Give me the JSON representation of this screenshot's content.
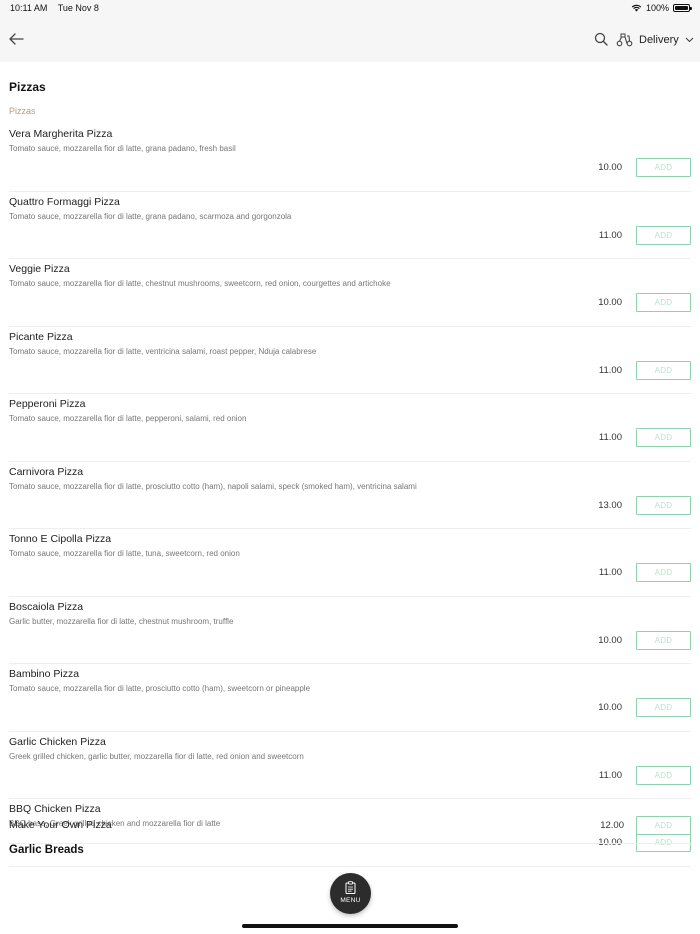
{
  "status_bar": {
    "time": "10:11 AM",
    "date": "Tue Nov 8",
    "battery": "100%",
    "battery_level": 1.0
  },
  "nav": {
    "back_icon": "arrow-left-icon",
    "search_icon": "search-icon",
    "delivery_icon": "scooter-icon",
    "delivery_label": "Delivery",
    "chevron_icon": "chevron-down-icon"
  },
  "section": {
    "title": "Pizzas",
    "subtitle": "Pizzas"
  },
  "items": [
    {
      "name": "Vera Margherita Pizza",
      "description": "Tomato sauce, mozzarella fior di latte, grana padano, fresh basil",
      "price": "10.00",
      "add_label": "ADD"
    },
    {
      "name": "Quattro Formaggi Pizza",
      "description": "Tomato sauce, mozzarella fior di latte, grana padano, scarmoza and gorgonzola",
      "price": "11.00",
      "add_label": "ADD"
    },
    {
      "name": "Veggie Pizza",
      "description": "Tomato sauce, mozzarella fior di latte, chestnut mushrooms, sweetcorn, red onion, courgettes and artichoke",
      "price": "10.00",
      "add_label": "ADD"
    },
    {
      "name": "Picante Pizza",
      "description": "Tomato sauce, mozzarella fior di latte, ventricina salami, roast pepper, Nduja calabrese",
      "price": "11.00",
      "add_label": "ADD"
    },
    {
      "name": "Pepperoni Pizza",
      "description": "Tomato sauce, mozzarella fior di latte, pepperoni, salami, red onion",
      "price": "11.00",
      "add_label": "ADD"
    },
    {
      "name": "Carnivora Pizza",
      "description": "Tomato sauce, mozzarella fior di latte, prosciutto cotto (ham), napoli salami, speck (smoked ham), ventricina salami",
      "price": "13.00",
      "add_label": "ADD"
    },
    {
      "name": "Tonno E Cipolla Pizza",
      "description": "Tomato sauce, mozzarella fior di latte, tuna, sweetcorn, red onion",
      "price": "11.00",
      "add_label": "ADD"
    },
    {
      "name": "Boscaiola Pizza",
      "description": "Garlic butter, mozzarella fior di latte, chestnut mushroom, truffle",
      "price": "10.00",
      "add_label": "ADD"
    },
    {
      "name": "Bambino Pizza",
      "description": "Tomato sauce, mozzarella fior di latte, prosciutto cotto (ham), sweetcorn or pineapple",
      "price": "10.00",
      "add_label": "ADD"
    },
    {
      "name": "Garlic Chicken Pizza",
      "description": "Greek grilled chicken, garlic butter, mozzarella fior di latte, red onion and sweetcorn",
      "price": "11.00",
      "add_label": "ADD"
    },
    {
      "name": "BBQ Chicken Pizza",
      "description": "BBQ base, Greek grilled chicken and mozzarella fior di latte",
      "price": "10.00",
      "add_label": "ADD"
    }
  ],
  "make_own": {
    "name": "Make Your Own Pizza",
    "price": "12.00",
    "add_label": "ADD"
  },
  "next_section": {
    "title": "Garlic Breads"
  },
  "menu_button": {
    "label": "MENU",
    "icon": "clipboard-icon"
  },
  "colors": {
    "accent_border": "#8fd3ae",
    "add_text": "#b9e3cc",
    "subtitle": "#b89a80"
  }
}
